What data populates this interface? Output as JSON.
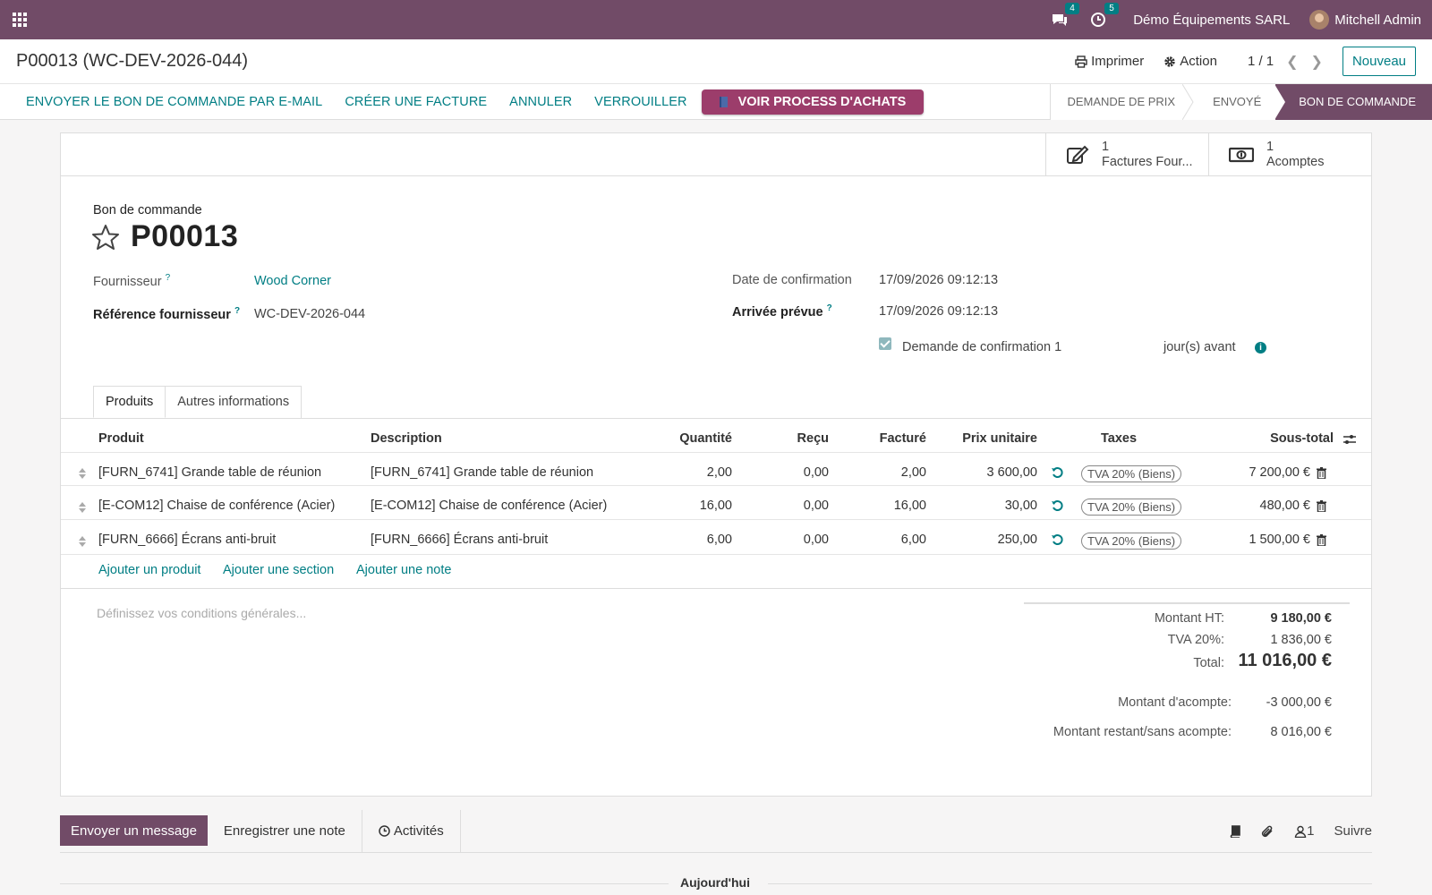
{
  "navbar": {
    "messages_badge": "4",
    "activities_badge": "5",
    "company": "Démo Équipements SARL",
    "user": "Mitchell Admin",
    "brand_color": "#714B67"
  },
  "control": {
    "breadcrumb": "P00013 (WC-DEV-2026-044)",
    "print_label": "Imprimer",
    "action_label": "Action",
    "pager": "1 / 1",
    "new_label": "Nouveau"
  },
  "statusbar": {
    "buttons": [
      "Envoyer le bon de commande par e-mail",
      "Créer une facture",
      "Annuler",
      "Verrouiller"
    ],
    "primary_label": "VOIR PROCESS D'ACHATS",
    "stages": [
      "Demande de prix",
      "Envoyé",
      "Bon de commande"
    ],
    "active_stage": "Bon de commande"
  },
  "smart_buttons": [
    {
      "count": "1",
      "label": "Factures Four...",
      "icon": "edit-icon"
    },
    {
      "count": "1",
      "label": "Acomptes",
      "icon": "money-icon"
    }
  ],
  "form": {
    "title_label": "Bon de commande",
    "title": "P00013",
    "vendor_label": "Fournisseur",
    "vendor": "Wood Corner",
    "vendor_ref_label": "Référence fournisseur",
    "vendor_ref": "WC-DEV-2026-044",
    "confirm_date_label": "Date de confirmation",
    "confirm_date": "17/09/2026 09:12:13",
    "expected_label": "Arrivée prévue",
    "expected": "17/09/2026 09:12:13",
    "ask_confirm_label": "Demande de confirmation",
    "ask_confirm_days": "1",
    "days_before": "jour(s) avant",
    "help_mark": "?"
  },
  "tabs": [
    "Produits",
    "Autres informations"
  ],
  "table": {
    "headers": [
      "Produit",
      "Description",
      "Quantité",
      "Reçu",
      "Facturé",
      "Prix unitaire",
      "Taxes",
      "Sous-total"
    ],
    "rows": [
      {
        "product": "[FURN_6741] Grande table de réunion",
        "description": "[FURN_6741] Grande table de réunion",
        "qty": "2,00",
        "received": "0,00",
        "invoiced": "2,00",
        "price": "3 600,00",
        "tax": "TVA 20% (Biens)",
        "subtotal": "7 200,00 €"
      },
      {
        "product": "[E-COM12] Chaise de conférence (Acier)",
        "description": "[E-COM12] Chaise de conférence (Acier)",
        "qty": "16,00",
        "received": "0,00",
        "invoiced": "16,00",
        "price": "30,00",
        "tax": "TVA 20% (Biens)",
        "subtotal": "480,00 €"
      },
      {
        "product": "[FURN_6666] Écrans anti-bruit",
        "description": "[FURN_6666] Écrans anti-bruit",
        "qty": "6,00",
        "received": "0,00",
        "invoiced": "6,00",
        "price": "250,00",
        "tax": "TVA 20% (Biens)",
        "subtotal": "1 500,00 €"
      }
    ],
    "add_product": "Ajouter un produit",
    "add_section": "Ajouter une section",
    "add_note": "Ajouter une note"
  },
  "footer": {
    "terms_placeholder": "Définissez vos conditions générales...",
    "untaxed_label": "Montant HT:",
    "untaxed": "9 180,00 €",
    "vat_label": "TVA 20%:",
    "vat": "1 836,00 €",
    "total_label": "Total:",
    "total": "11 016,00 €",
    "down_payment_label": "Montant d'acompte:",
    "down_payment": "-3 000,00 €",
    "remaining_label": "Montant restant/sans acompte:",
    "remaining": "8 016,00 €"
  },
  "chatter": {
    "send_message": "Envoyer un message",
    "log_note": "Enregistrer une note",
    "activities": "Activités",
    "followers_count": "1",
    "follow": "Suivre",
    "today": "Aujourd'hui"
  }
}
